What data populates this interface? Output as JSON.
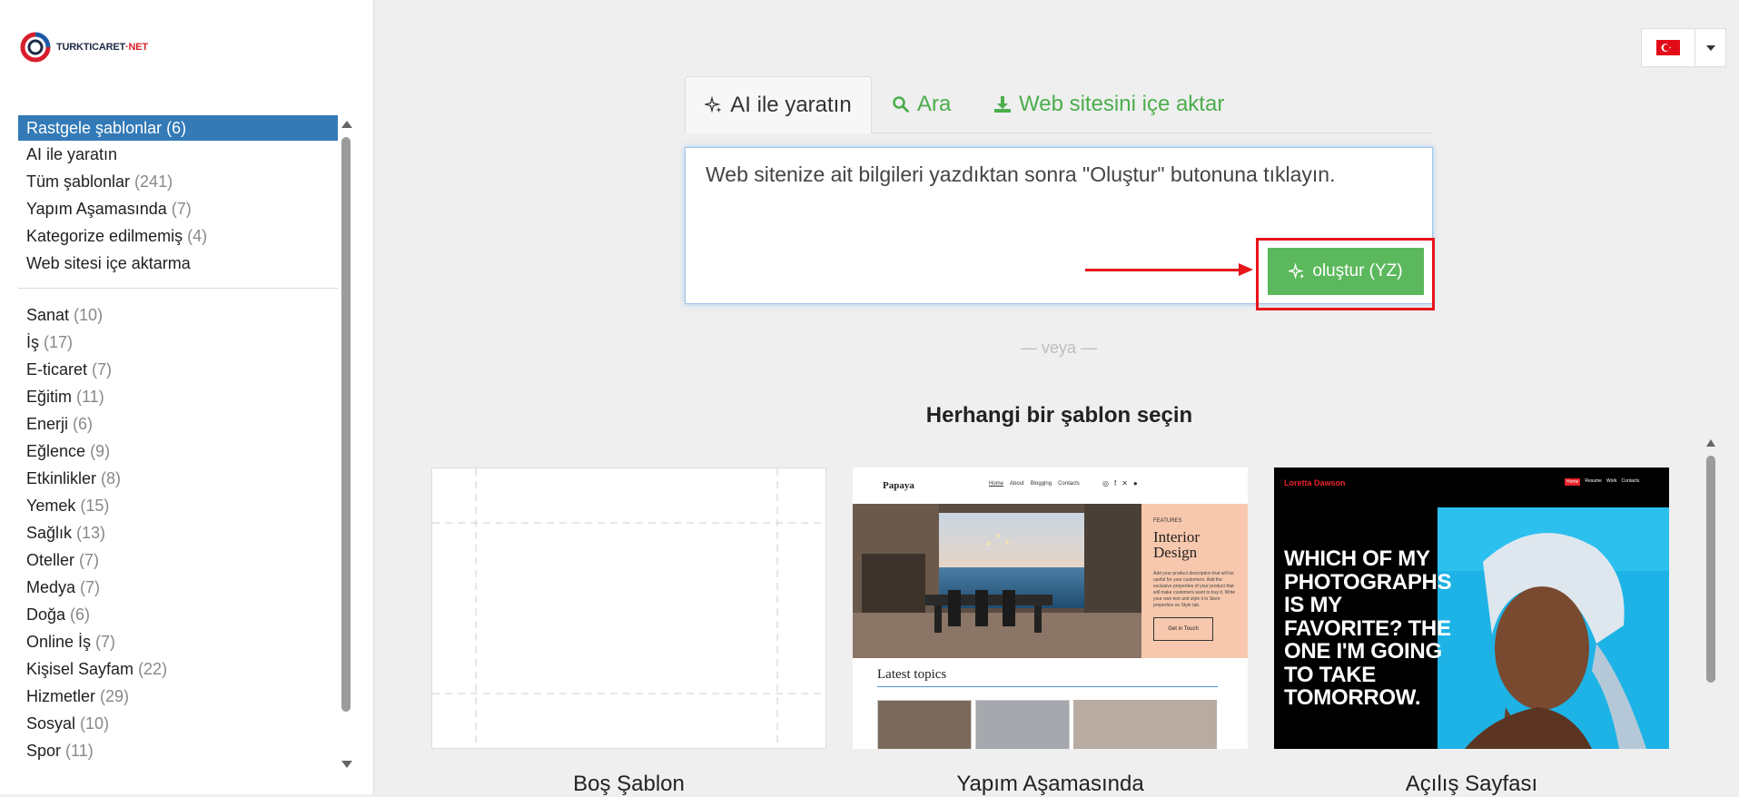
{
  "logo": {
    "text_main": "TURKTICARET",
    "text_net": "·NET"
  },
  "language": {
    "flag": "turkey-flag-icon"
  },
  "categories_top": [
    {
      "label": "Rastgele şablonlar",
      "count": "(6)",
      "active": true
    },
    {
      "label": "AI ile yaratın",
      "count": ""
    },
    {
      "label": "Tüm şablonlar",
      "count": "(241)"
    },
    {
      "label": "Yapım Aşamasında",
      "count": "(7)"
    },
    {
      "label": "Kategorize edilmemiş",
      "count": "(4)"
    },
    {
      "label": "Web sitesi içe aktarma",
      "count": ""
    }
  ],
  "categories": [
    {
      "label": "Sanat",
      "count": "(10)"
    },
    {
      "label": "İş",
      "count": "(17)"
    },
    {
      "label": "E-ticaret",
      "count": "(7)"
    },
    {
      "label": "Eğitim",
      "count": "(11)"
    },
    {
      "label": "Enerji",
      "count": "(6)"
    },
    {
      "label": "Eğlence",
      "count": "(9)"
    },
    {
      "label": "Etkinlikler",
      "count": "(8)"
    },
    {
      "label": "Yemek",
      "count": "(15)"
    },
    {
      "label": "Sağlık",
      "count": "(13)"
    },
    {
      "label": "Oteller",
      "count": "(7)"
    },
    {
      "label": "Medya",
      "count": "(7)"
    },
    {
      "label": "Doğa",
      "count": "(6)"
    },
    {
      "label": "Online İş",
      "count": "(7)"
    },
    {
      "label": "Kişisel Sayfam",
      "count": "(22)"
    },
    {
      "label": "Hizmetler",
      "count": "(29)"
    },
    {
      "label": "Sosyal",
      "count": "(10)"
    },
    {
      "label": "Spor",
      "count": "(11)"
    }
  ],
  "tabs": {
    "ai": "AI ile yaratın",
    "search": "Ara",
    "import": "Web sitesini içe aktar"
  },
  "prompt": {
    "placeholder": "Web sitenize ait bilgileri yazdıktan sonra \"Oluştur\" butonuna tıklayın.",
    "button": "oluştur (YZ)"
  },
  "or_text": "— veya —",
  "section_title": "Herhangi bir şablon seçin",
  "templates": [
    {
      "name": "Boş Şablon"
    },
    {
      "name": "Yapım Aşamasında",
      "preview": {
        "brand": "Papaya",
        "nav": [
          "Home",
          "About",
          "Blogging",
          "Contacts"
        ],
        "features_label": "FEATURES",
        "heading_line1": "Interior",
        "heading_line2": "Design",
        "body": "Add your product description that will be useful for your customers. Add the exclusive properties of your product that will make customers want to buy it. Write your own text and style it in Store properties on Style tab.",
        "cta": "Get in Touch",
        "latest": "Latest topics"
      }
    },
    {
      "name": "Açılış Sayfası",
      "preview": {
        "brand": "Loretta Dawson",
        "nav": [
          "Home",
          "Resume",
          "Work",
          "Contacts"
        ],
        "headline": [
          "WHICH OF MY",
          "PHOTOGRAPHS",
          "IS MY",
          "FAVORITE? THE",
          "ONE I'M GOING",
          "TO TAKE",
          "TOMORROW."
        ]
      }
    }
  ],
  "colors": {
    "accent_blue": "#337ab7",
    "green": "#5cb85c",
    "red_annotation": "#e8141b",
    "template_red": "#e8222a"
  }
}
